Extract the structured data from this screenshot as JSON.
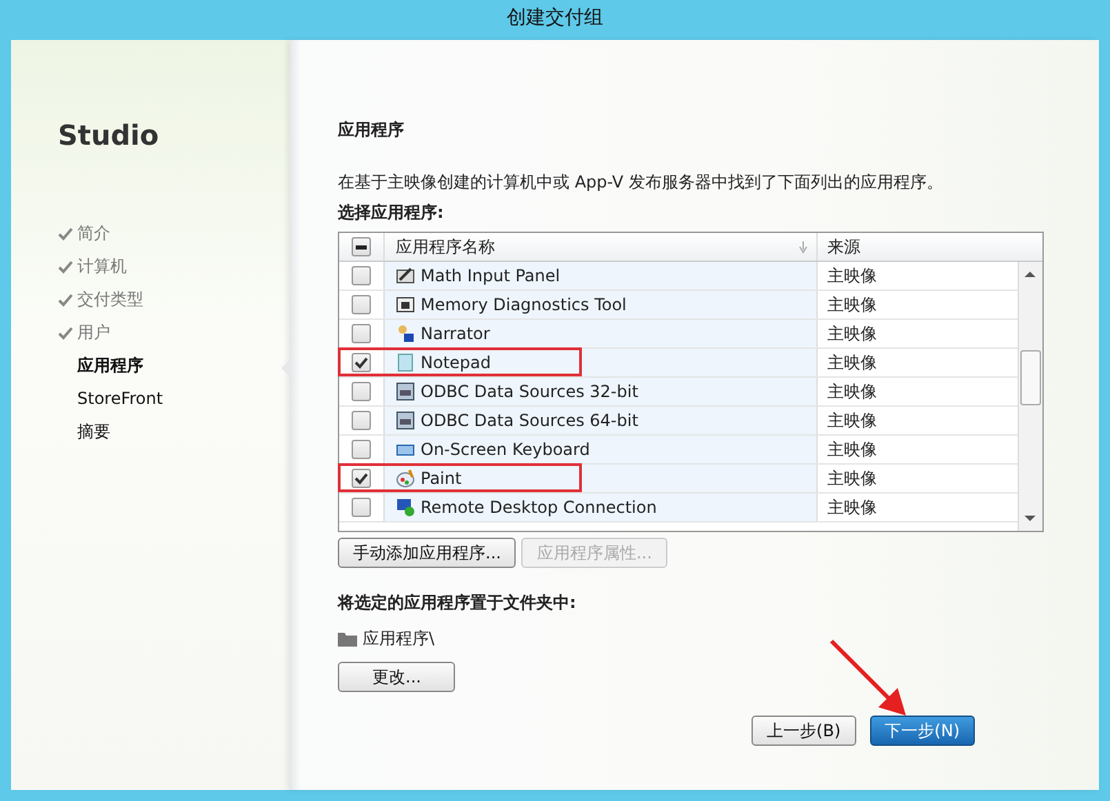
{
  "window": {
    "title": "创建交付组"
  },
  "sidebar": {
    "title": "Studio",
    "items": [
      {
        "label": "简介",
        "done": true,
        "selected": false
      },
      {
        "label": "计算机",
        "done": true,
        "selected": false
      },
      {
        "label": "交付类型",
        "done": true,
        "selected": false
      },
      {
        "label": "用户",
        "done": true,
        "selected": false
      },
      {
        "label": "应用程序",
        "done": false,
        "selected": true
      },
      {
        "label": "StoreFront",
        "done": false,
        "selected": false
      },
      {
        "label": "摘要",
        "done": false,
        "selected": false
      }
    ]
  },
  "page": {
    "heading": "应用程序",
    "description": "在基于主映像创建的计算机中或 App-V 发布服务器中找到了下面列出的应用程序。",
    "select_label": "选择应用程序:"
  },
  "table": {
    "columns": [
      "应用程序名称",
      "来源"
    ],
    "header_checkbox_partial": true,
    "rows": [
      {
        "name": "Math Input Panel",
        "source": "主映像",
        "checked": false,
        "highlighted": false
      },
      {
        "name": "Memory Diagnostics Tool",
        "source": "主映像",
        "checked": false,
        "highlighted": false
      },
      {
        "name": "Narrator",
        "source": "主映像",
        "checked": false,
        "highlighted": false
      },
      {
        "name": "Notepad",
        "source": "主映像",
        "checked": true,
        "highlighted": true
      },
      {
        "name": "ODBC Data Sources 32-bit",
        "source": "主映像",
        "checked": false,
        "highlighted": false
      },
      {
        "name": "ODBC Data Sources 64-bit",
        "source": "主映像",
        "checked": false,
        "highlighted": false
      },
      {
        "name": "On-Screen Keyboard",
        "source": "主映像",
        "checked": false,
        "highlighted": false
      },
      {
        "name": "Paint",
        "source": "主映像",
        "checked": true,
        "highlighted": true
      },
      {
        "name": "Remote Desktop Connection",
        "source": "主映像",
        "checked": false,
        "highlighted": false
      }
    ]
  },
  "table_buttons": [
    {
      "label": "手动添加应用程序...",
      "disabled": false
    },
    {
      "label": "应用程序属性...",
      "disabled": true
    }
  ],
  "folder": {
    "label": "将选定的应用程序置于文件夹中:",
    "path": "应用程序\\",
    "change_button": "更改..."
  },
  "footer_buttons": [
    {
      "label": "上一步(B)",
      "primary": false,
      "pointed": false
    },
    {
      "label": "下一步(N)",
      "primary": true,
      "pointed": true
    }
  ]
}
